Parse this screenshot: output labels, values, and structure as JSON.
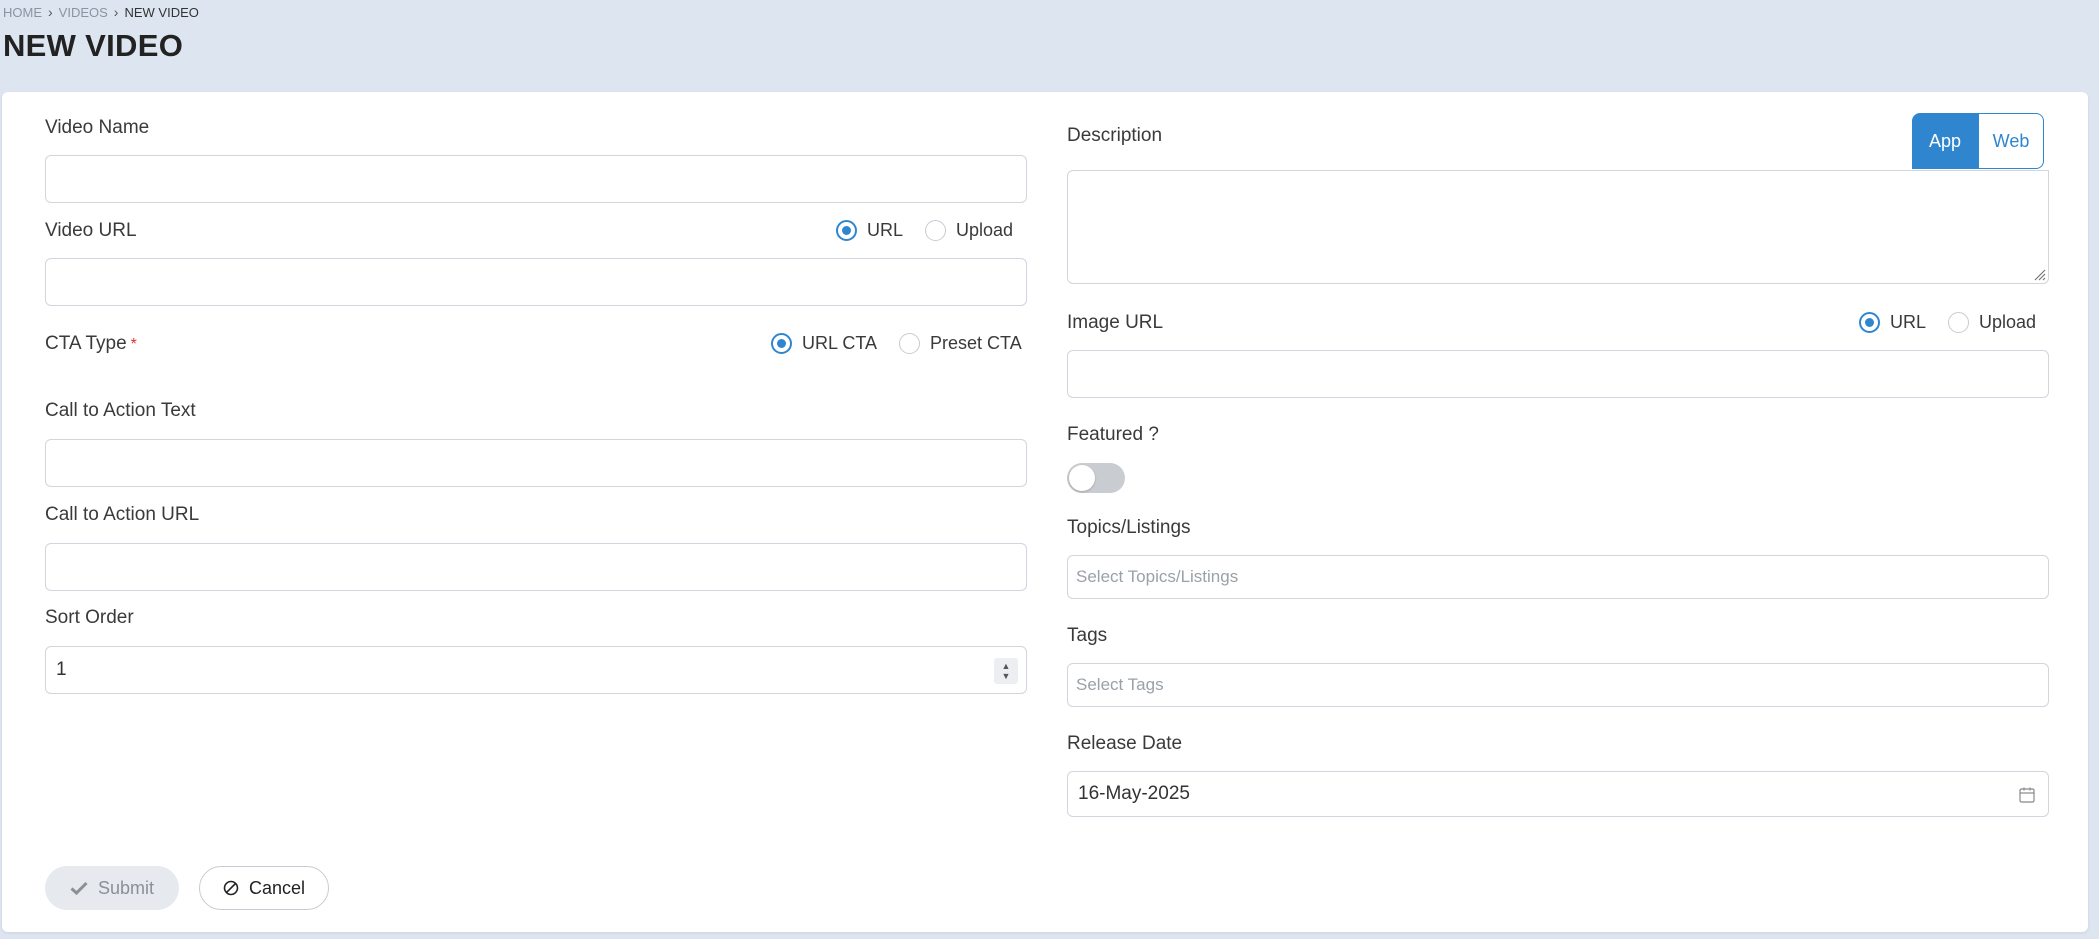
{
  "breadcrumb": {
    "home": "HOME",
    "videos": "VIDEOS",
    "current": "NEW VIDEO"
  },
  "page_title": "NEW VIDEO",
  "form": {
    "video_name": {
      "label": "Video Name",
      "value": ""
    },
    "video_url": {
      "label": "Video URL",
      "value": "",
      "options": [
        "URL",
        "Upload"
      ],
      "selected": "URL"
    },
    "cta_type": {
      "label": "CTA Type",
      "required_mark": "*",
      "options": [
        "URL CTA",
        "Preset CTA"
      ],
      "selected": "URL CTA"
    },
    "cta_text": {
      "label": "Call to Action Text",
      "value": ""
    },
    "cta_url": {
      "label": "Call to Action URL",
      "value": ""
    },
    "sort_order": {
      "label": "Sort Order",
      "value": "1"
    },
    "description": {
      "label": "Description",
      "tabs": [
        "App",
        "Web"
      ],
      "selected_tab": "App",
      "value": ""
    },
    "image_url": {
      "label": "Image URL",
      "value": "",
      "options": [
        "URL",
        "Upload"
      ],
      "selected": "URL"
    },
    "featured": {
      "label": "Featured ?",
      "on": false
    },
    "topics": {
      "label": "Topics/Listings",
      "placeholder": "Select Topics/Listings"
    },
    "tags": {
      "label": "Tags",
      "placeholder": "Select Tags"
    },
    "release_date": {
      "label": "Release Date",
      "value": "16-May-2025"
    }
  },
  "actions": {
    "submit_label": "Submit",
    "cancel_label": "Cancel"
  },
  "colors": {
    "accent": "#2f86cf",
    "background": "#dde6f0",
    "required": "#e03131"
  },
  "icons": [
    "chevron-right-icon",
    "check-icon",
    "ban-icon",
    "calendar-icon",
    "resize-grip-icon",
    "spinner-arrows-icon"
  ]
}
